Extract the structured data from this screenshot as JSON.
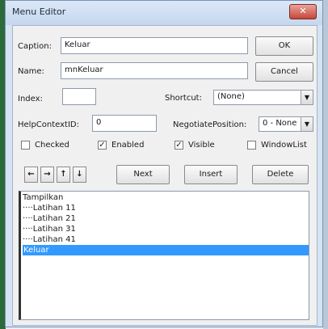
{
  "window": {
    "title": "Menu Editor",
    "close_glyph": "✕"
  },
  "form": {
    "caption_label": "Caption:",
    "caption_value": "Keluar",
    "name_label": "Name:",
    "name_value": "mnKeluar",
    "index_label": "Index:",
    "index_value": "",
    "shortcut_label": "Shortcut:",
    "shortcut_value": "(None)",
    "helpcontext_label": "HelpContextID:",
    "helpcontext_value": "0",
    "negotiate_label": "NegotiatePosition:",
    "negotiate_value": "0 - None"
  },
  "buttons": {
    "ok": "OK",
    "cancel": "Cancel",
    "next": "Next",
    "insert": "Insert",
    "delete": "Delete"
  },
  "checkboxes": [
    {
      "label": "Checked",
      "checked": false
    },
    {
      "label": "Enabled",
      "checked": true
    },
    {
      "label": "Visible",
      "checked": true
    },
    {
      "label": "WindowList",
      "checked": false
    }
  ],
  "arrows": [
    "←",
    "→",
    "↑",
    "↓"
  ],
  "menu_items": [
    {
      "text": "Tampilkan",
      "selected": false
    },
    {
      "text": "····Latihan 11",
      "selected": false
    },
    {
      "text": "····Latihan 21",
      "selected": false
    },
    {
      "text": "····Latihan 31",
      "selected": false
    },
    {
      "text": "····Latihan 41",
      "selected": false
    },
    {
      "text": "Keluar",
      "selected": true
    }
  ],
  "combo_arrow": "▼"
}
